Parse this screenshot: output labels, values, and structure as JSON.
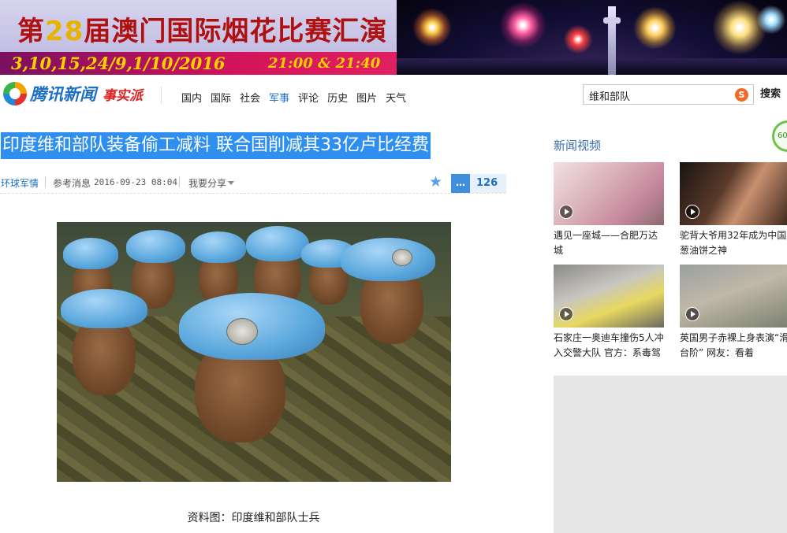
{
  "banner": {
    "title_prefix": "第",
    "title_number": "28",
    "title_suffix": "届澳门国际烟花比赛汇演",
    "dates": "3,10,15,24/9,1/10/2016",
    "times": "21:00 & 21:40"
  },
  "nav": {
    "logo_text": "腾讯新闻",
    "logo_sub": "事实派",
    "links": [
      "国内",
      "国际",
      "社会",
      "军事",
      "评论",
      "历史",
      "图片",
      "天气"
    ],
    "active_link": "军事",
    "search_value": "维和部队",
    "search_button": "搜索"
  },
  "article": {
    "headline": "印度维和部队装备偷工减料 联合国削减其33亿卢比经费",
    "source": "环球军情",
    "origin": "参考消息",
    "time": "2016-09-23 08:04",
    "share": "我要分享",
    "comment_count": "126",
    "caption": "资料图：印度维和部队士兵"
  },
  "sidebar": {
    "title": "新闻视频",
    "badge": "60%",
    "videos": [
      {
        "caption": "遇见一座城——合肥万达城"
      },
      {
        "caption": "驼背大爷用32年成为中国葱油饼之神"
      },
      {
        "caption": "石家庄一奥迪车撞伤5人冲入交警大队 官方：系毒驾"
      },
      {
        "caption": "英国男子赤裸上身表演“滑台阶” 网友：看着"
      }
    ]
  },
  "colors": {
    "headline_bg": "#2f8ff0",
    "link_blue": "#1d6fc4",
    "banner_red": "#b01010"
  }
}
